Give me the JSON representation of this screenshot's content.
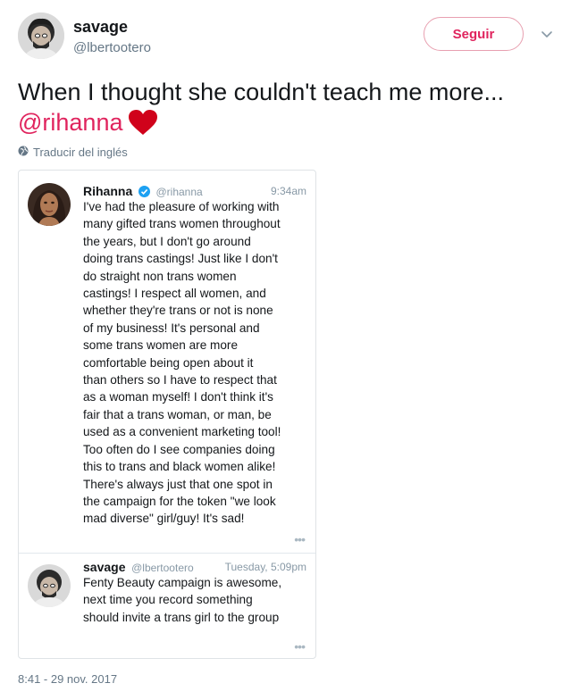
{
  "author": {
    "display_name": "savage",
    "handle": "@lbertootero",
    "follow_label": "Seguir"
  },
  "tweet": {
    "text": "When I thought she couldn't teach me more...",
    "mention": "@rihanna",
    "translate_label": "Traducir del inglés",
    "timestamp": "8:41 - 29 nov. 2017"
  },
  "embedded": {
    "card1": {
      "name": "Rihanna",
      "handle": "@rihanna",
      "time": "9:34am",
      "verified": true,
      "lines": [
        "I've had the pleasure of working with",
        "many gifted trans women throughout",
        "the years, but I don't go around",
        "doing trans castings! Just like I don't",
        "do straight non trans women",
        "castings! I respect all women, and",
        "whether they're trans or not is none",
        "of my business! It's personal and",
        "some trans women are more",
        "comfortable being open about it",
        "than others so I have to respect that",
        "as a woman myself! I don't think it's",
        "fair that a trans woman, or man, be",
        "used as a convenient marketing tool!",
        "Too often do I see companies doing",
        "this to trans and black women alike!",
        "There's always just that one spot in",
        "the campaign for the token \"we look",
        "mad diverse\" girl/guy! It's sad!"
      ],
      "more": "•••"
    },
    "card2": {
      "name": "savage",
      "handle": "@lbertootero",
      "time": "Tuesday, 5:09pm",
      "lines": [
        "Fenty Beauty campaign is awesome,",
        "next time you record something",
        "should invite a trans girl to the group"
      ],
      "more": "•••"
    }
  },
  "colors": {
    "accent": "#e0245e",
    "muted": "#657786",
    "verified": "#1da1f2"
  },
  "icons": [
    "chevron-down-icon",
    "globe-icon",
    "heart-icon",
    "verified-badge-icon"
  ]
}
